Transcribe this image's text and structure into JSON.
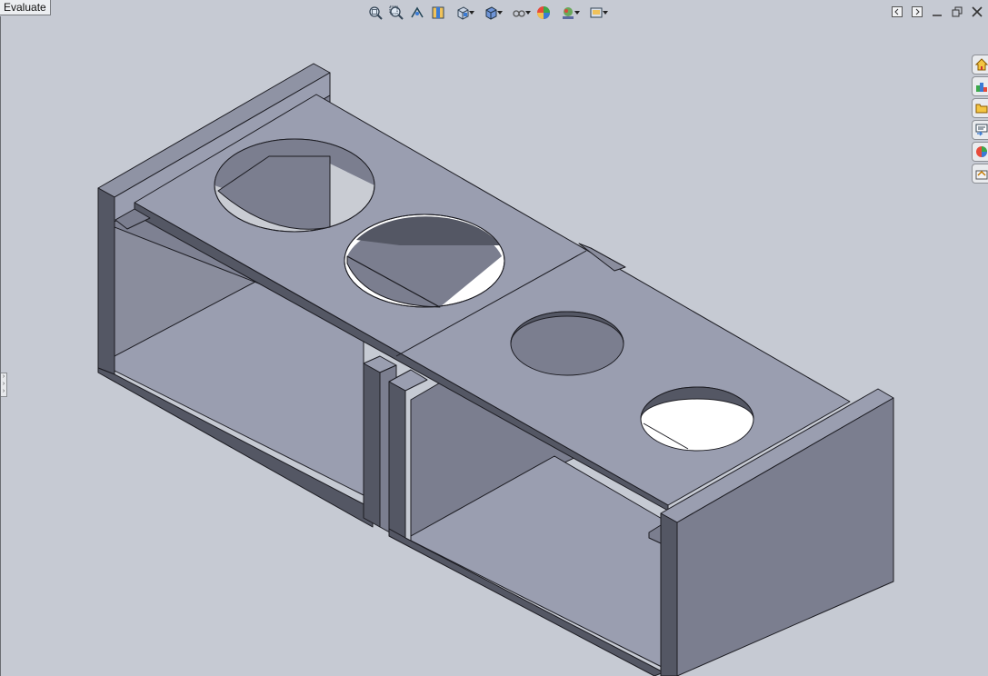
{
  "tab": {
    "label": "Evaluate"
  },
  "toolbar": {
    "items": [
      "zoom-to-fit-icon",
      "zoom-to-area-icon",
      "previous-view-icon",
      "section-view-icon",
      "view-orientation-icon",
      "display-style-icon",
      "hide-show-items-icon",
      "edit-appearance-icon",
      "apply-scene-icon",
      "view-settings-icon"
    ]
  },
  "window_controls": [
    "tile-left-icon",
    "tile-right-icon",
    "minimize-icon",
    "restore-icon",
    "close-icon"
  ],
  "task_pane": {
    "tabs": [
      "solidworks-resources-icon",
      "design-library-icon",
      "file-explorer-icon",
      "view-palette-icon",
      "appearances-scenes-icon",
      "custom-properties-icon"
    ]
  },
  "colors": {
    "background": "#c6cad3",
    "model_light": "#9a9eb0",
    "model_mid": "#7b7e8f",
    "model_dark": "#545764",
    "edge": "#1c1c22"
  }
}
